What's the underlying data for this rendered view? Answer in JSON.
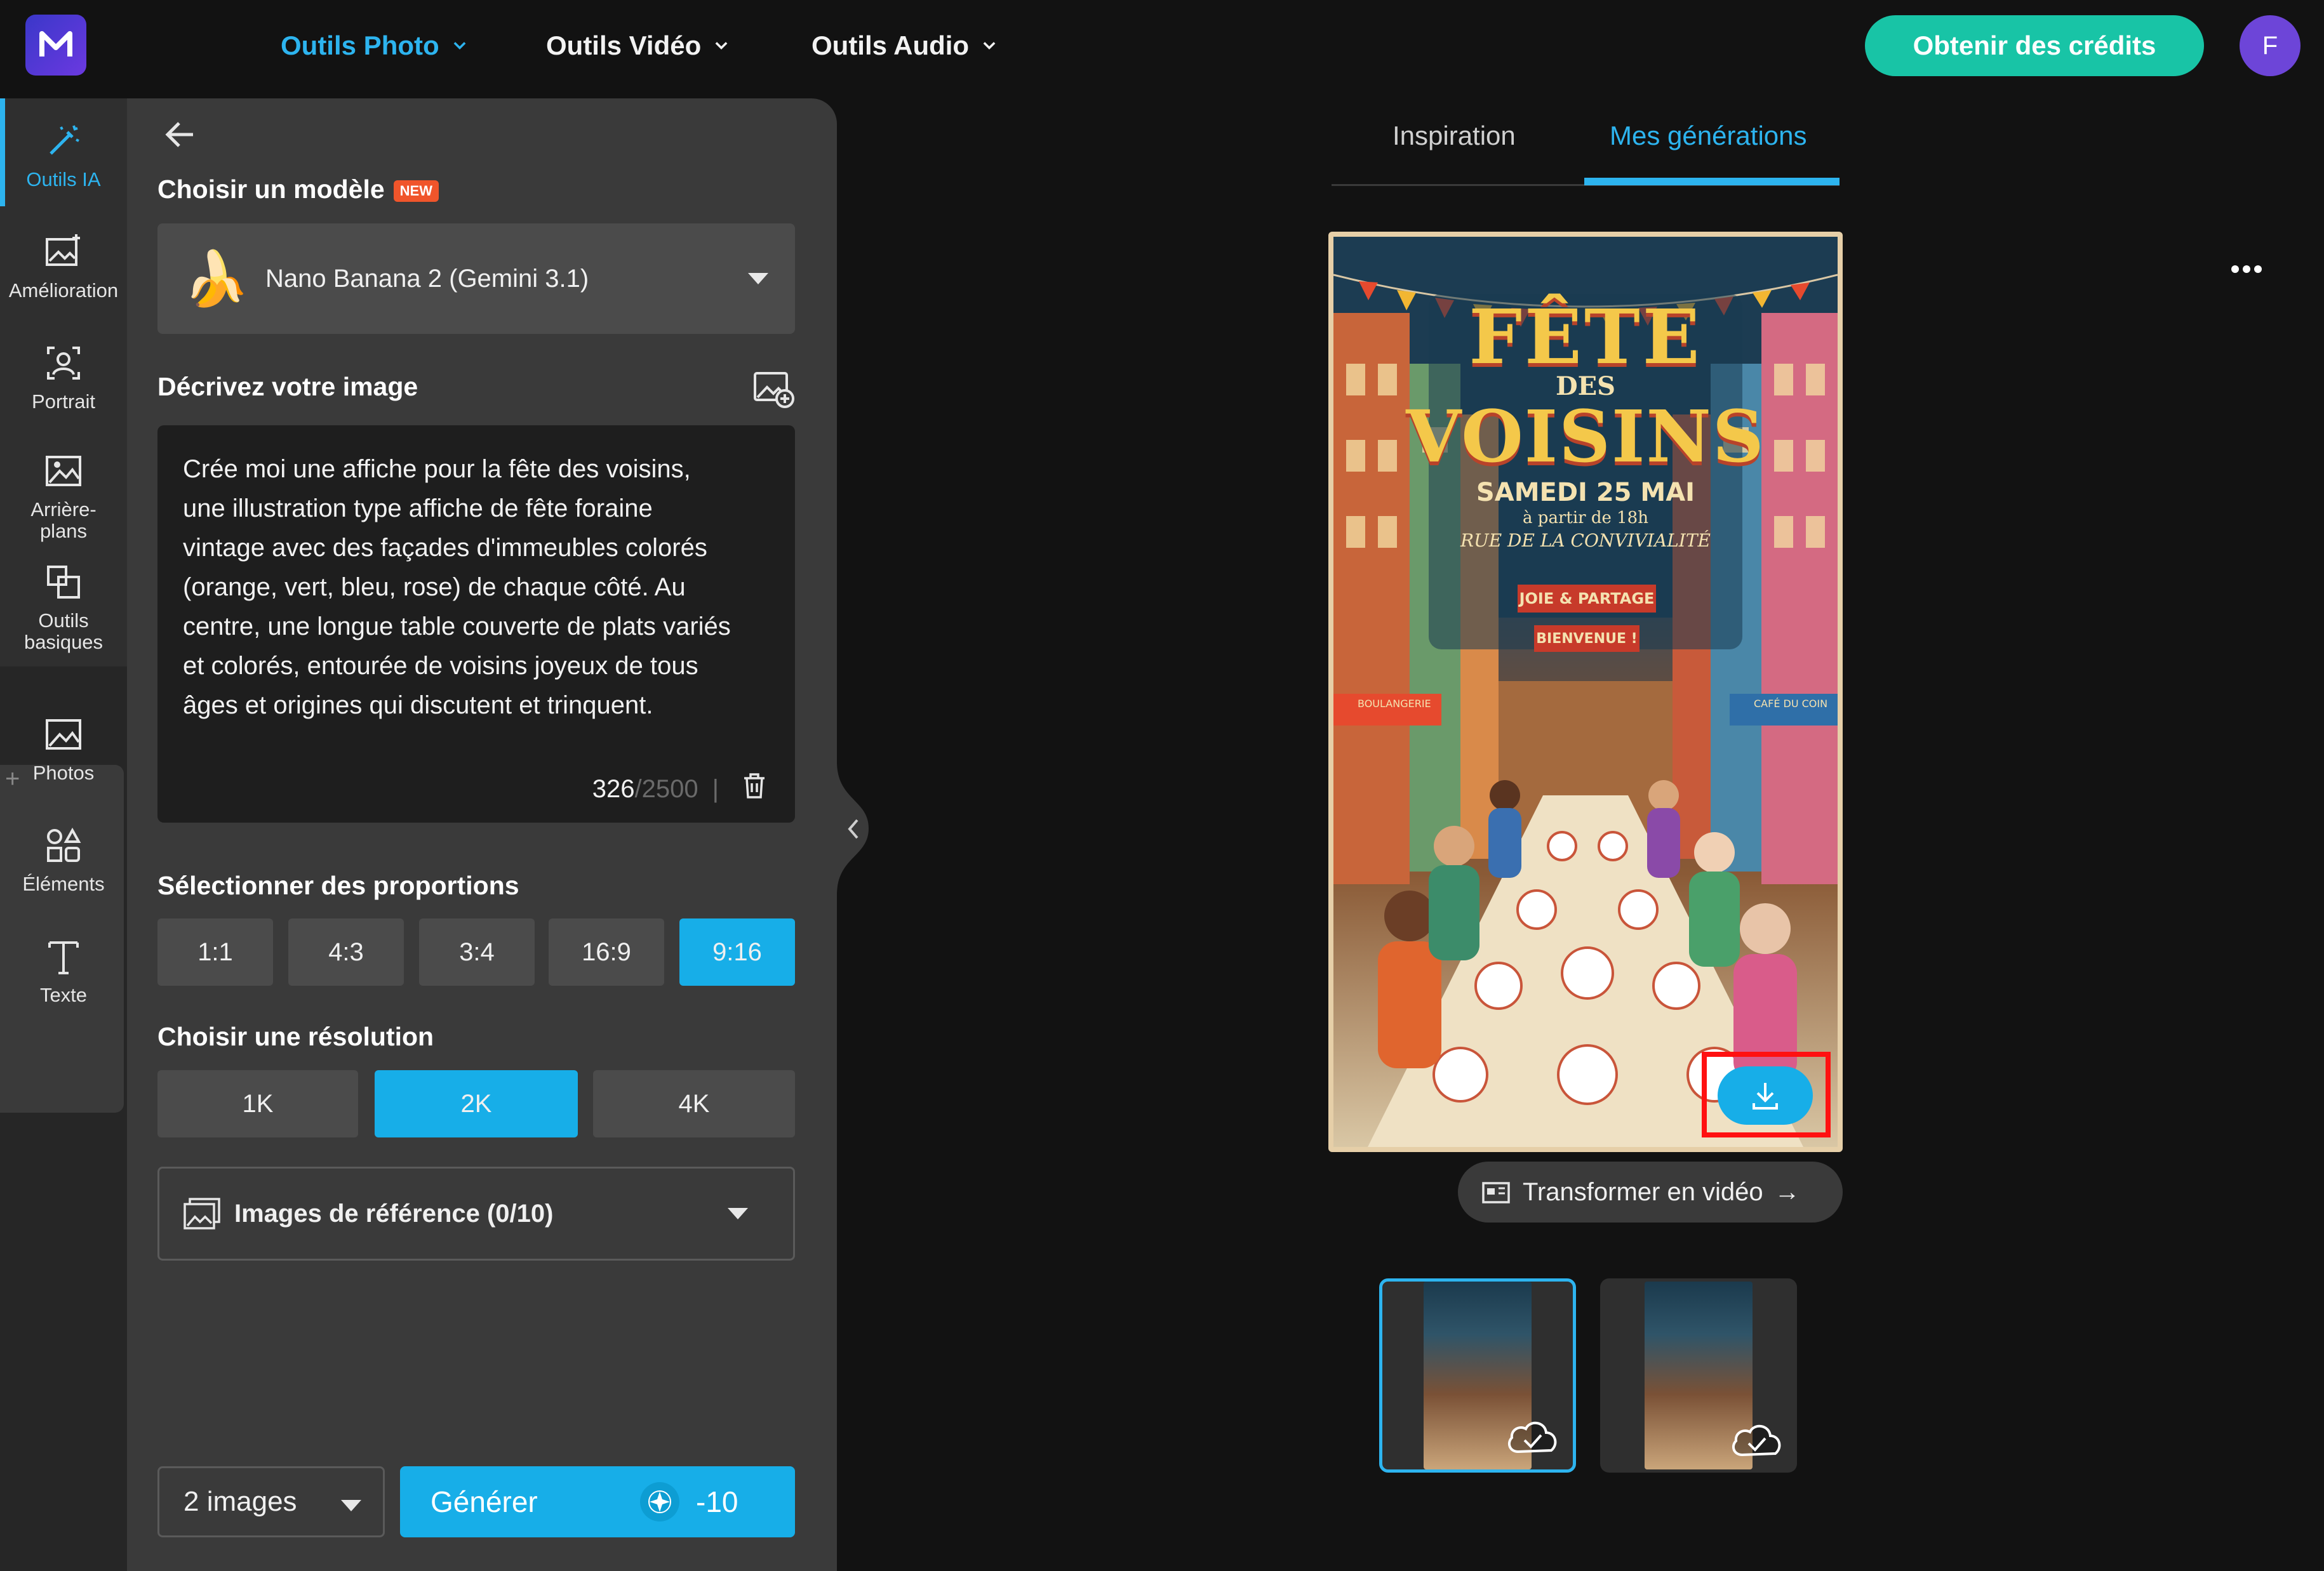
{
  "header": {
    "nav": [
      {
        "label": "Outils Photo",
        "active": true
      },
      {
        "label": "Outils Vidéo",
        "active": false
      },
      {
        "label": "Outils Audio",
        "active": false
      }
    ],
    "credits_button": "Obtenir des crédits",
    "avatar_initial": "F"
  },
  "rail": {
    "items": [
      {
        "label": "Outils IA",
        "icon": "magic-wand-icon"
      },
      {
        "label": "Amélioration",
        "icon": "image-enhance-icon"
      },
      {
        "label": "Portrait",
        "icon": "portrait-icon"
      },
      {
        "label": "Arrière-\nplans",
        "icon": "background-icon"
      },
      {
        "label": "Outils\nbasiques",
        "icon": "crop-tools-icon"
      },
      {
        "label": "Photos",
        "icon": "photo-icon"
      },
      {
        "label": "Éléments",
        "icon": "elements-icon"
      },
      {
        "label": "Texte",
        "icon": "text-icon"
      }
    ],
    "add_symbol": "+"
  },
  "panel": {
    "model_section_title": "Choisir un modèle",
    "new_badge": "NEW",
    "model_name": "Nano Banana 2 (Gemini 3.1)",
    "model_emoji": "🍌",
    "describe_title": "Décrivez votre image",
    "prompt": "Crée moi une affiche pour la fête des voisins,\nune illustration type affiche de fête foraine\nvintage avec des façades d'immeubles colorés\n(orange, vert, bleu, rose) de chaque côté. Au\ncentre, une longue table couverte de plats variés\net colorés, entourée de voisins joyeux de tous\nâges et origines qui discutent et trinquent.",
    "char_count": "326",
    "char_max": "/2500",
    "char_sep": "|",
    "proportions_title": "Sélectionner des proportions",
    "proportions": [
      {
        "label": "1:1",
        "selected": false
      },
      {
        "label": "4:3",
        "selected": false
      },
      {
        "label": "3:4",
        "selected": false
      },
      {
        "label": "16:9",
        "selected": false
      },
      {
        "label": "9:16",
        "selected": true
      }
    ],
    "resolution_title": "Choisir une résolution",
    "resolutions": [
      {
        "label": "1K",
        "selected": false
      },
      {
        "label": "2K",
        "selected": true
      },
      {
        "label": "4K",
        "selected": false
      }
    ],
    "reference_images": "Images de référence (0/10)",
    "image_count": "2 images",
    "generate_label": "Générer",
    "generate_cost": "-10"
  },
  "main": {
    "tabs": [
      {
        "label": "Inspiration",
        "active": false
      },
      {
        "label": "Mes générations",
        "active": true
      }
    ],
    "poster": {
      "title_line1": "FÊTE",
      "title_line2": "DES",
      "title_line3": "VOISINS",
      "date": "SAMEDI 25 MAI",
      "time": "à partir de 18h",
      "street": "RUE DE LA CONVIVIALITÉ",
      "banner1": "JOIE & PARTAGE",
      "banner2": "BIENVENUE !",
      "shop_left": "BOULANGERIE",
      "shop_right": "CAFÉ DU COIN"
    },
    "to_video_label": "Transformer en vidéo",
    "to_video_arrow": "→"
  },
  "colors": {
    "accent": "#2db4ef",
    "button_blue": "#17aee8",
    "credits_green": "#18c4a6",
    "highlight_red": "#ff1111"
  }
}
